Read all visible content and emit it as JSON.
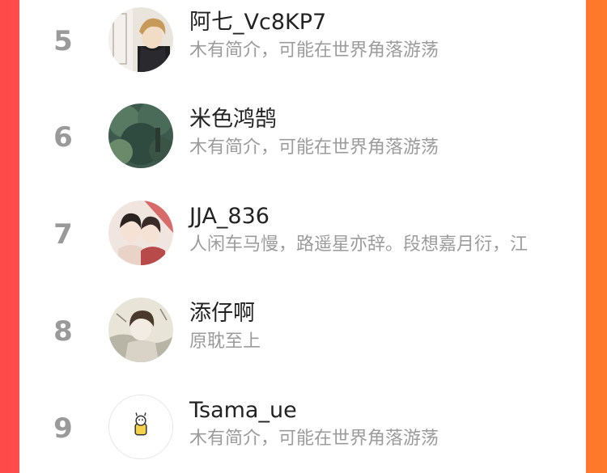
{
  "ranking": [
    {
      "rank": "5",
      "name": "阿七_Vc8KP7",
      "bio": "木有简介，可能在世界角落游荡",
      "avatar_icon": "anime-boy-avatar-icon"
    },
    {
      "rank": "6",
      "name": "米色鸿鹄",
      "bio": "木有简介，可能在世界角落游荡",
      "avatar_icon": "forest-landscape-avatar-icon"
    },
    {
      "rank": "7",
      "name": "JJA_836",
      "bio": "人闲车马慢，路遥星亦辞。段想嘉月衍，江",
      "avatar_icon": "anime-couple-avatar-icon"
    },
    {
      "rank": "8",
      "name": "添仔啊",
      "bio": "原耽至上",
      "avatar_icon": "sketch-boy-avatar-icon"
    },
    {
      "rank": "9",
      "name": "Tsama_ue",
      "bio": "木有简介，可能在世界角落游荡",
      "avatar_icon": "cartoon-sticker-avatar-icon"
    }
  ],
  "colors": {
    "background_left": "#ff4a4a",
    "background_right": "#ff7a2a",
    "rank_gray": "#9a9a9a",
    "name_text": "#222222",
    "bio_text": "#9b9b9b"
  }
}
